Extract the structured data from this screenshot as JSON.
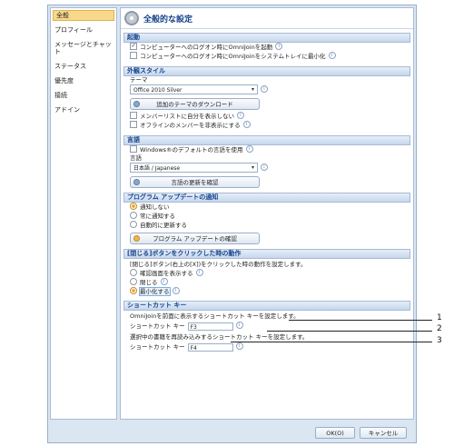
{
  "sidebar": {
    "items": [
      {
        "label": "全般",
        "active": true
      },
      {
        "label": "プロフィール"
      },
      {
        "label": "メッセージとチャット"
      },
      {
        "label": "ステータス"
      },
      {
        "label": "優先度"
      },
      {
        "label": "接続"
      },
      {
        "label": "アドイン"
      }
    ]
  },
  "header": {
    "title": "全般的な設定"
  },
  "startup": {
    "title": "起動",
    "opt1": "コンピューターへのログオン時にOmniJoinを起動",
    "opt1_checked": "✓",
    "opt2": "コンピューターへのログオン時にOmniJoinをシステムトレイに最小化"
  },
  "appearance": {
    "title": "外観スタイル",
    "theme_label": "テーマ",
    "theme_value": "Office 2010 Silver",
    "download_btn": "追加のテーマのダウンロード",
    "opt1": "メンバーリストに自分を表示しない",
    "opt2": "オフラインのメンバーを非表示にする"
  },
  "language": {
    "title": "言語",
    "default_opt": "Windows®のデフォルトの言語を使用",
    "lang_label": "言語",
    "lang_value": "日本語 / Japanese",
    "update_btn": "言語の更新を確認"
  },
  "update": {
    "title": "プログラム アップデートの通知",
    "opt1": "通知しない",
    "opt2": "常に通知する",
    "opt3": "自動的に更新する",
    "check_btn": "プログラム アップデートの確認"
  },
  "close_action": {
    "title": "[閉じる]ボタンをクリックした時の動作",
    "desc": "[閉じる]ボタン(右上の[X])をクリックした時の動作を設定します。",
    "opt1": "確認画面を表示する",
    "opt2": "閉じる",
    "opt3": "最小化する"
  },
  "shortcut": {
    "title": "ショートカット キー",
    "desc1": "OmniJoinを前面に表示するショートカット キーを設定します。",
    "key_label1": "ショートカット キー",
    "key_value1": "F3",
    "desc2": "選択中の書籍を再読み込みするショートカット キーを設定します。",
    "key_label2": "ショートカット キー",
    "key_value2": "F4"
  },
  "footer": {
    "ok": "OK(O)",
    "cancel": "キャンセル"
  },
  "callouts": [
    "1",
    "2",
    "3"
  ],
  "info_glyph": "i",
  "arrow_glyph": "▾",
  "colors": {
    "accent": "#15428b",
    "highlight": "#f8d98b",
    "radio_on": "#e8a023"
  }
}
